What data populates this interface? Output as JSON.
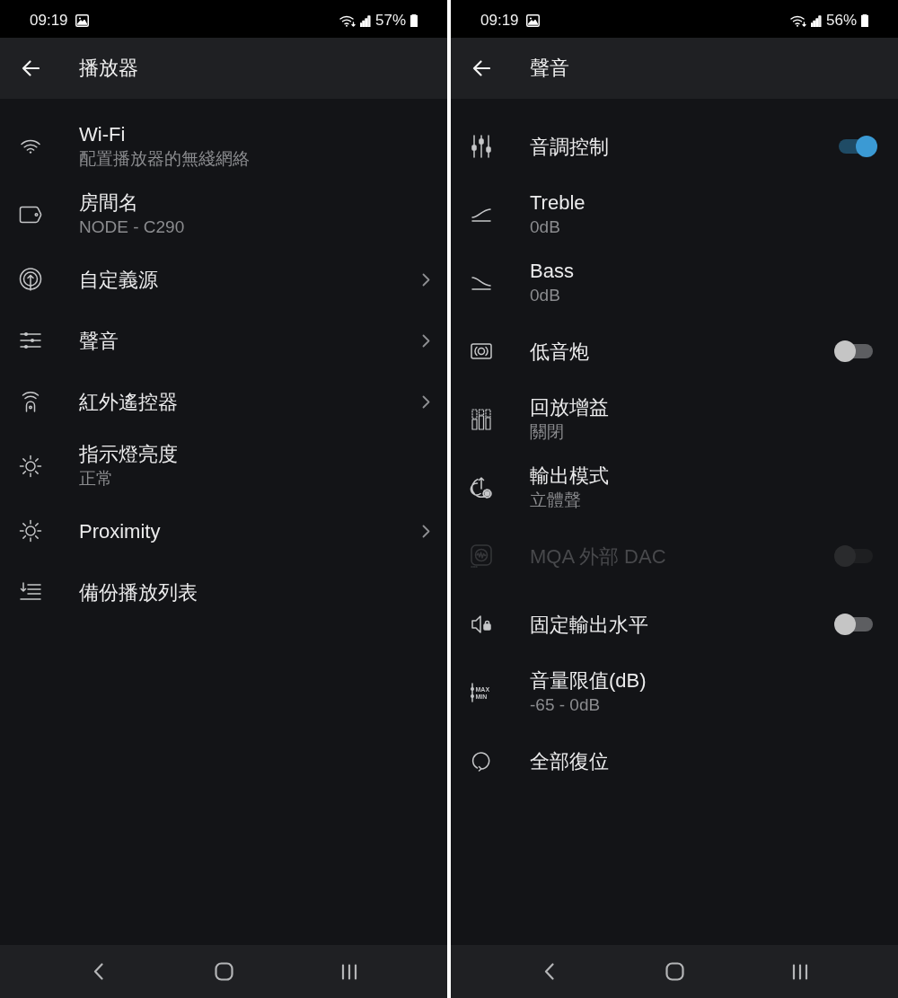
{
  "screens": [
    {
      "status_bar": {
        "time": "09:19",
        "battery": "57%"
      },
      "app_bar": {
        "title": "播放器"
      },
      "items": [
        {
          "kind": "plain",
          "title": "Wi-Fi",
          "subtitle": "配置播放器的無綫網絡"
        },
        {
          "kind": "plain",
          "title": "房間名",
          "subtitle": "NODE - C290"
        },
        {
          "kind": "link",
          "title": "自定義源"
        },
        {
          "kind": "link",
          "title": "聲音"
        },
        {
          "kind": "link",
          "title": "紅外遙控器"
        },
        {
          "kind": "plain",
          "title": "指示燈亮度",
          "subtitle": "正常"
        },
        {
          "kind": "link",
          "title": "Proximity"
        },
        {
          "kind": "plain",
          "title": "備份播放列表"
        }
      ]
    },
    {
      "status_bar": {
        "time": "09:19",
        "battery": "56%"
      },
      "app_bar": {
        "title": "聲音"
      },
      "items": [
        {
          "kind": "switch",
          "title": "音調控制",
          "on": true,
          "disabled": false
        },
        {
          "kind": "plain",
          "title": "Treble",
          "subtitle": "0dB",
          "disabled": false
        },
        {
          "kind": "plain",
          "title": "Bass",
          "subtitle": "0dB",
          "disabled": false
        },
        {
          "kind": "switch",
          "title": "低音炮",
          "on": false,
          "disabled": false
        },
        {
          "kind": "plain",
          "title": "回放增益",
          "subtitle": "關閉",
          "disabled": false
        },
        {
          "kind": "plain",
          "title": "輸出模式",
          "subtitle": "立體聲",
          "disabled": false
        },
        {
          "kind": "switch",
          "title": "MQA 外部 DAC",
          "on": false,
          "disabled": true
        },
        {
          "kind": "switch",
          "title": "固定輸出水平",
          "on": false,
          "disabled": false
        },
        {
          "kind": "plain",
          "title": "音量限值(dB)",
          "subtitle": "-65 - 0dB",
          "icon_labels": [
            "MAX",
            "MIN"
          ],
          "disabled": false
        },
        {
          "kind": "plain",
          "title": "全部復位",
          "disabled": false
        }
      ]
    }
  ]
}
